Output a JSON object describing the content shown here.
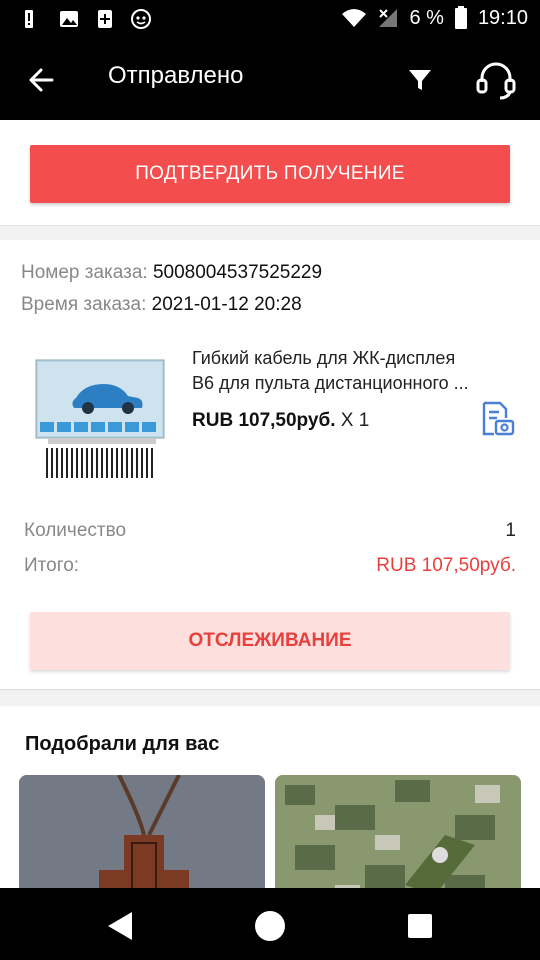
{
  "status_bar": {
    "battery": "6 %",
    "time": "19:10",
    "icons": [
      "alert-icon",
      "image-icon",
      "plus-icon",
      "app-badge-icon",
      "wifi-icon",
      "signal-off-icon",
      "battery-icon"
    ]
  },
  "app_bar": {
    "title": "Отправлено",
    "icons": [
      "back-arrow-icon",
      "filter-icon",
      "headset-icon"
    ]
  },
  "confirm_button": "ПОДТВЕРДИТЬ ПОЛУЧЕНИЕ",
  "order": {
    "number_label": "Номер заказа:",
    "number_value": "5008004537525229",
    "time_label": "Время заказа:",
    "time_value": "2021-01-12 20:28",
    "product": {
      "title_line1": "Гибкий кабель для ЖК-дисплея",
      "title_line2": "B6 для пульта дистанционного ...",
      "price": "RUB 107,50руб.",
      "quantity": "X 1"
    },
    "quantity_label": "Количество",
    "quantity_value": "1",
    "total_label": "Итого:",
    "total_value": "RUB 107,50руб."
  },
  "tracking_button": "ОТСЛЕЖИВАНИЕ",
  "recommendations": {
    "title": "Подобрали для вас"
  },
  "colors": {
    "accent": "#f44d4d",
    "tracking_bg": "#fde0de",
    "tracking_text": "#e8403c",
    "price_red": "#e8403c",
    "icon_blue": "#4a7fd6"
  }
}
